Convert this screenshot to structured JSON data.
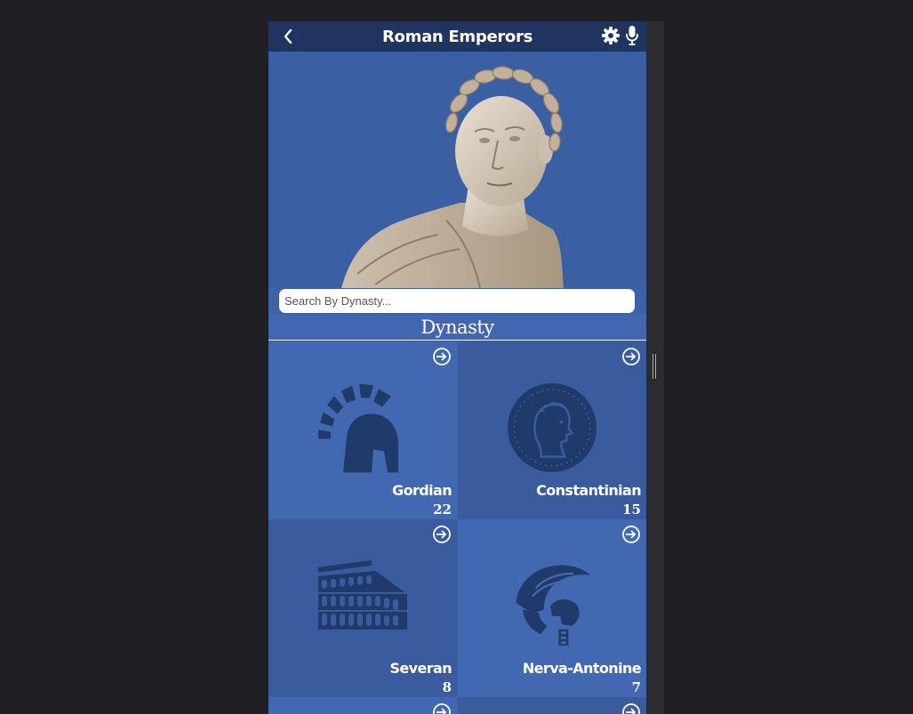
{
  "app": {
    "title": "Roman Emperors"
  },
  "search": {
    "placeholder": "Search By Dynasty..."
  },
  "section": {
    "heading": "Dynasty"
  },
  "colors": {
    "topbar": "#1f3560",
    "hero_bg": "#3b5fa3",
    "tile_light": "#4268b2",
    "tile_dark": "#3a5c9f",
    "icon_fill": "#203a6a"
  },
  "icons": {
    "back": "chevron-left-icon",
    "settings": "gear-icon",
    "voice": "microphone-icon",
    "open": "arrow-right-circle-icon"
  },
  "dynasties": [
    {
      "name": "Gordian",
      "count": "22",
      "icon": "spartan-helmet-icon"
    },
    {
      "name": "Constantinian",
      "count": "15",
      "icon": "laurel-coin-icon"
    },
    {
      "name": "Severan",
      "count": "8",
      "icon": "colosseum-icon"
    },
    {
      "name": "Nerva-Antonine",
      "count": "7",
      "icon": "centurion-helmet-icon"
    }
  ]
}
